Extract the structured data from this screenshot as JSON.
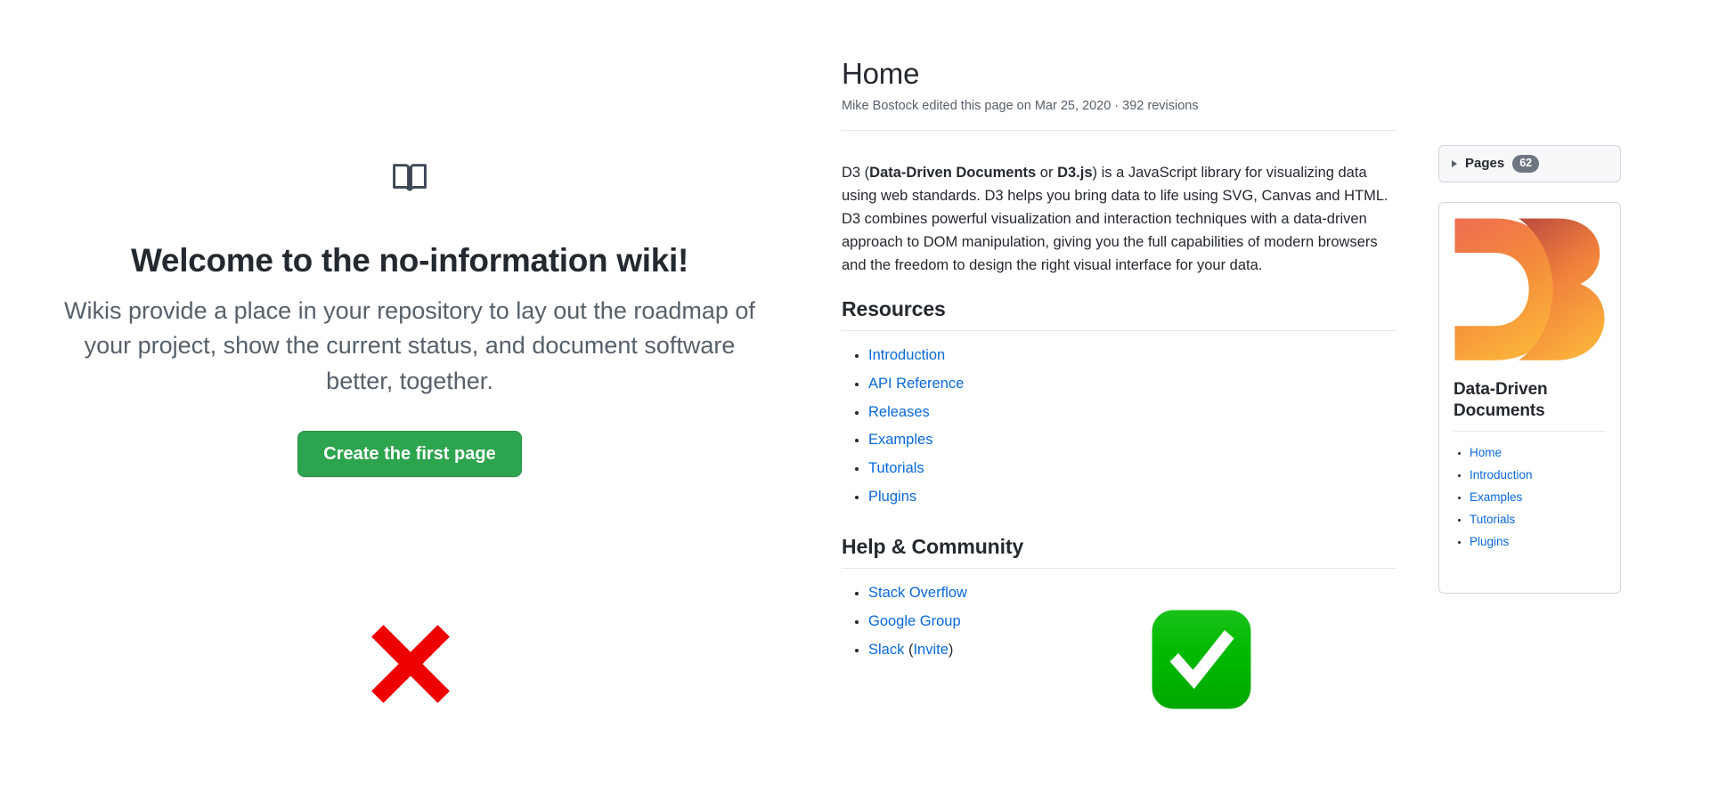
{
  "left_panel": {
    "icon": "open-book-icon",
    "title": "Welcome to the no-information wiki!",
    "description": "Wikis provide a place in your repository to lay out the roadmap of your project, show the current status, and document software better, together.",
    "button_label": "Create the first page",
    "button_color": "#2da44e"
  },
  "right_panel": {
    "page_title": "Home",
    "meta": "Mike Bostock edited this page on Mar 25, 2020 · 392 revisions",
    "paragraph": {
      "part1": "D3 (",
      "bold1": "Data-Driven Documents",
      "part2": " or ",
      "bold2": "D3.js",
      "part3": ") is a JavaScript library for visualizing data using web standards. D3 helps you bring data to life using SVG, Canvas and HTML. D3 combines powerful visualization and interaction techniques with a data-driven approach to DOM manipulation, giving you the full capabilities of modern browsers and the freedom to design the right visual interface for your data."
    },
    "sections": [
      {
        "heading": "Resources",
        "links": [
          "Introduction",
          "API Reference",
          "Releases",
          "Examples",
          "Tutorials",
          "Plugins"
        ]
      },
      {
        "heading": "Help & Community",
        "links": [
          "Stack Overflow",
          "Google Group",
          "Slack"
        ],
        "slack_invite_open": " (",
        "slack_invite": "Invite",
        "slack_invite_close": ")"
      }
    ],
    "sidebar": {
      "pages_toggle": {
        "icon": "triangle-right-icon",
        "label": "Pages",
        "count": "62"
      },
      "logo": {
        "name": "d3-logo",
        "gradient_start": "#f06d52",
        "gradient_mid": "#f08a38",
        "gradient_end": "#fbb03b"
      },
      "heading": "Data-Driven Documents",
      "links": [
        "Home",
        "Introduction",
        "Examples",
        "Tutorials",
        "Plugins"
      ]
    }
  },
  "verdicts": {
    "left": {
      "icon": "cross-mark-icon",
      "color": "#ee0000",
      "meaning": "bad example"
    },
    "right": {
      "icon": "check-mark-button-icon",
      "color": "#00b300",
      "meaning": "good example"
    }
  },
  "colors": {
    "link": "#0969da",
    "text": "#24292f",
    "muted": "#57606a",
    "border": "#d0d7de",
    "badge": "#6e7781"
  }
}
